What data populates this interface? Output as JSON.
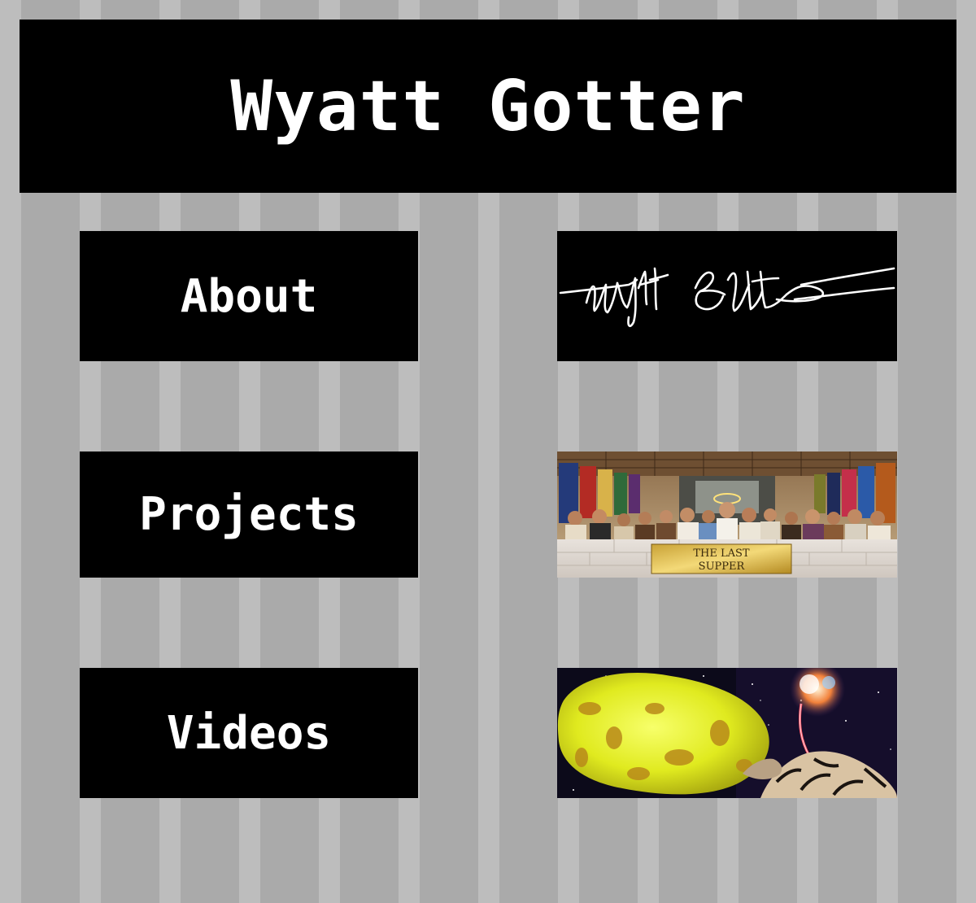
{
  "header": {
    "title": "Wyatt Gotter"
  },
  "nav": {
    "about_label": "About",
    "projects_label": "Projects",
    "videos_label": "Videos"
  },
  "thumbnails": {
    "signature": {
      "text": "Wyatt Gotter"
    },
    "projects": {
      "plaque_line1": "THE LAST",
      "plaque_line2": "SUPPER"
    },
    "videos": {
      "accent": "#e8f02a"
    }
  },
  "colors": {
    "stripe_light": "#bdbdbd",
    "stripe_dark": "#aaaaaa",
    "panel": "#000000",
    "text": "#ffffff"
  }
}
